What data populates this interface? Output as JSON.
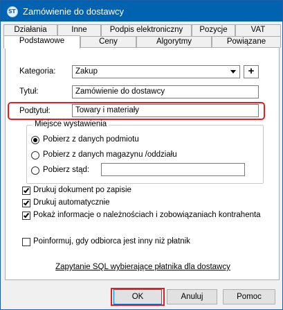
{
  "window": {
    "title": "Zamówienie do dostawcy",
    "icon": "app-logo-icon",
    "icon_text": "ST"
  },
  "tabs_back": [
    "Działania",
    "Inne",
    "Podpis elektroniczny",
    "Pozycje",
    "VAT"
  ],
  "tabs_front": [
    "Podstawowe",
    "Ceny",
    "Algorytmy",
    "Powiązane"
  ],
  "active_tab": "Podstawowe",
  "form": {
    "kategoria_label": "Kategoria:",
    "kategoria_value": "Zakup",
    "add_symbol": "+",
    "tytul_label": "Tytuł:",
    "tytul_value": "Zamówienie do dostawcy",
    "podtytul_label": "Podtytuł:",
    "podtytul_value": "Towary i materiały"
  },
  "miejsce": {
    "title": "Miejsce wystawienia",
    "options": [
      "Pobierz z danych podmiotu",
      "Pobierz z danych magazynu /oddziału",
      "Pobierz stąd:"
    ],
    "selected_index": 0,
    "custom_value": ""
  },
  "checks": [
    {
      "label": "Drukuj dokument po zapisie",
      "checked": true
    },
    {
      "label": "Drukuj automatycznie",
      "checked": true
    },
    {
      "label": "Pokaż informacje o należnościach i zobowiązaniach kontrahenta",
      "checked": true
    }
  ],
  "poinformuj": {
    "label": "Poinformuj, gdy odbiorca jest inny niż płatnik",
    "checked": false
  },
  "sql_link": "Zapytanie SQL wybierające płatnika dla dostawcy",
  "buttons": {
    "ok": "OK",
    "cancel": "Anuluj",
    "help": "Pomoc"
  },
  "colors": {
    "titlebar": "#0063b1",
    "highlight": "#e02020",
    "focus": "#0078d7"
  }
}
